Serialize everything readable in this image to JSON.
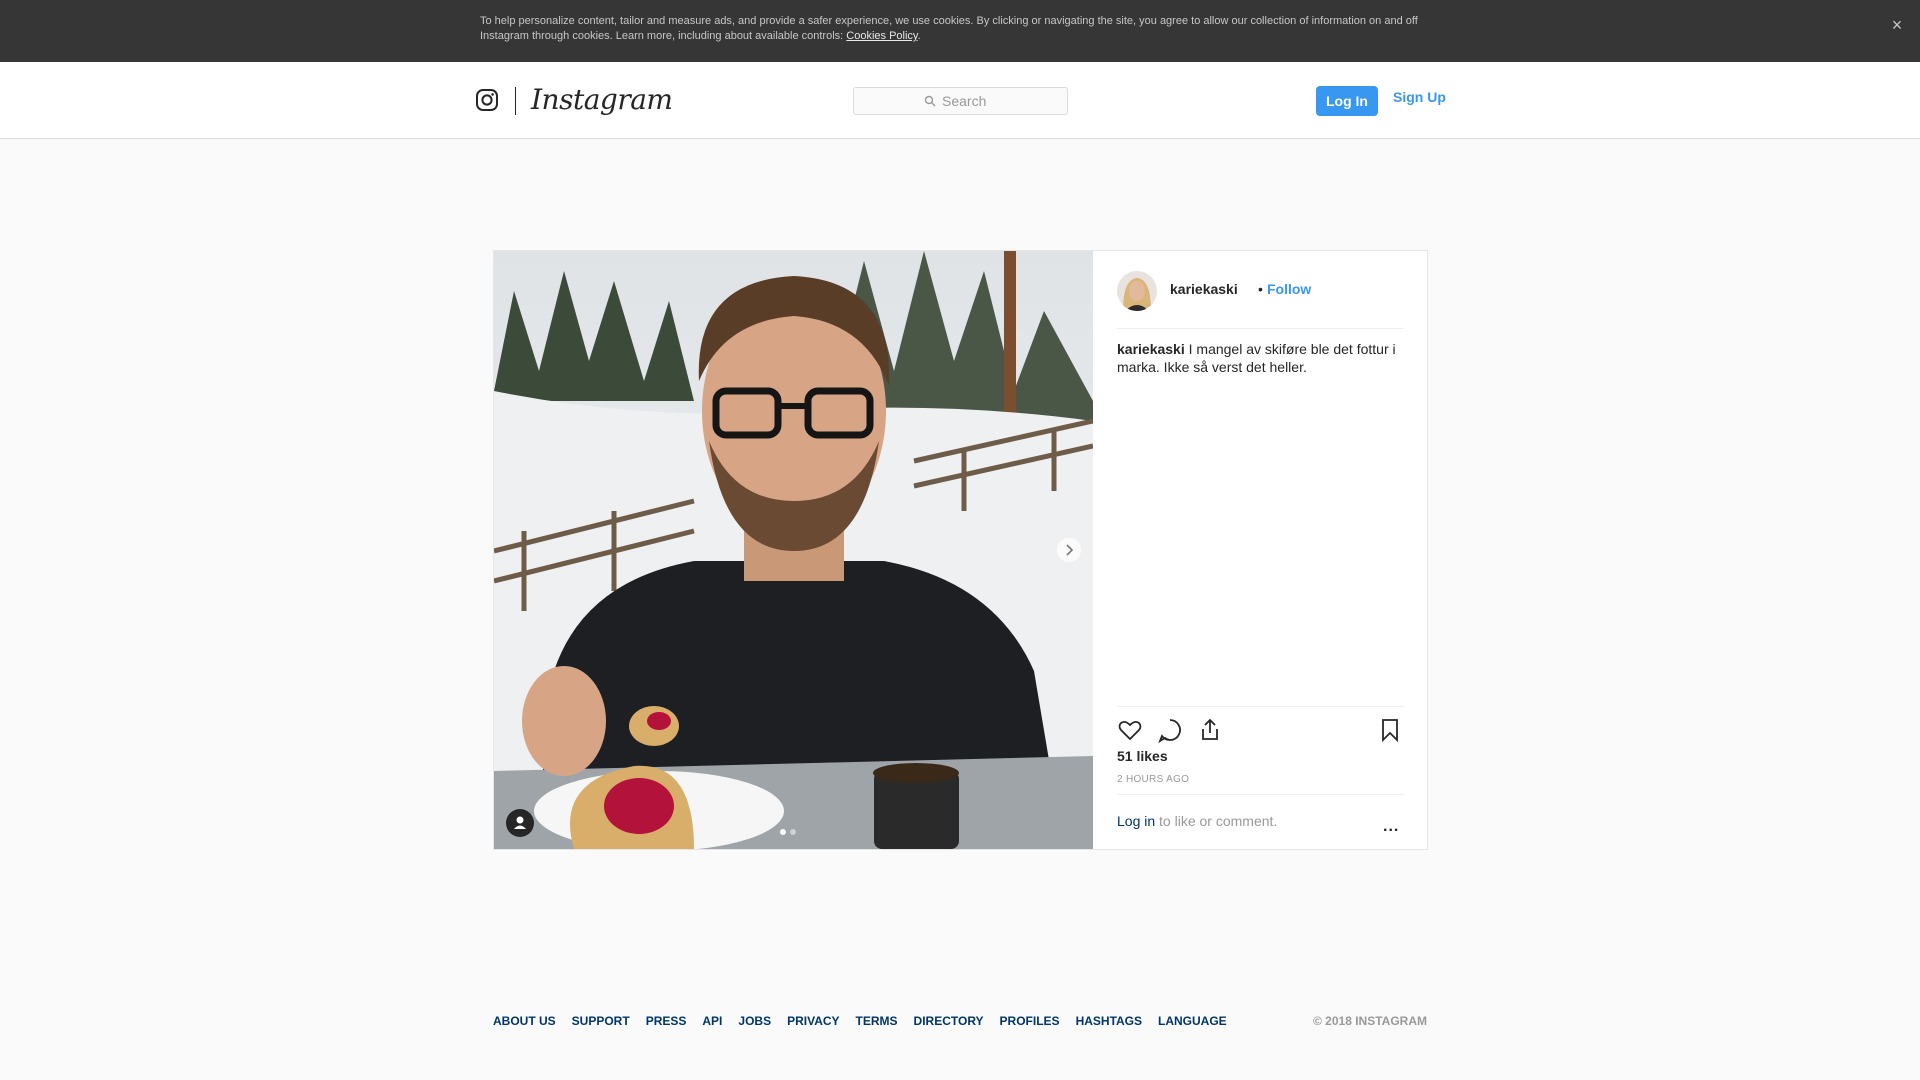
{
  "cookie_banner": {
    "text": "To help personalize content, tailor and measure ads, and provide a safer experience, we use cookies. By clicking or navigating the site, you agree to allow our collection of information on and off Instagram through cookies. Learn more, including about available controls: ",
    "link": "Cookies Policy",
    "suffix": ".",
    "close": "×"
  },
  "header": {
    "logo_icon": "instagram-camera-icon",
    "wordmark": "Instagram",
    "search_placeholder": "Search",
    "login_label": "Log In",
    "signup_label": "Sign Up",
    "accent_color": "#3897f0"
  },
  "post": {
    "username": "kariekaski",
    "bullet": "•",
    "follow_label": "Follow",
    "caption_user": "kariekaski",
    "caption_text": "I mangel av skiføre ble det fottur i marka. Ikke så verst det heller.",
    "likes": "51 likes",
    "time": "2 HOURS AGO",
    "login_link": "Log in",
    "login_rest": " to like or comment.",
    "more": "...",
    "carousel": {
      "total": 2,
      "active": 1
    },
    "icons": [
      "heart-icon",
      "comment-icon",
      "share-icon",
      "bookmark-icon",
      "tag-user-icon",
      "chevron-right-icon"
    ]
  },
  "footer": {
    "links": [
      "ABOUT US",
      "SUPPORT",
      "PRESS",
      "API",
      "JOBS",
      "PRIVACY",
      "TERMS",
      "DIRECTORY",
      "PROFILES",
      "HASHTAGS",
      "LANGUAGE"
    ],
    "copyright": "© 2018 INSTAGRAM"
  }
}
